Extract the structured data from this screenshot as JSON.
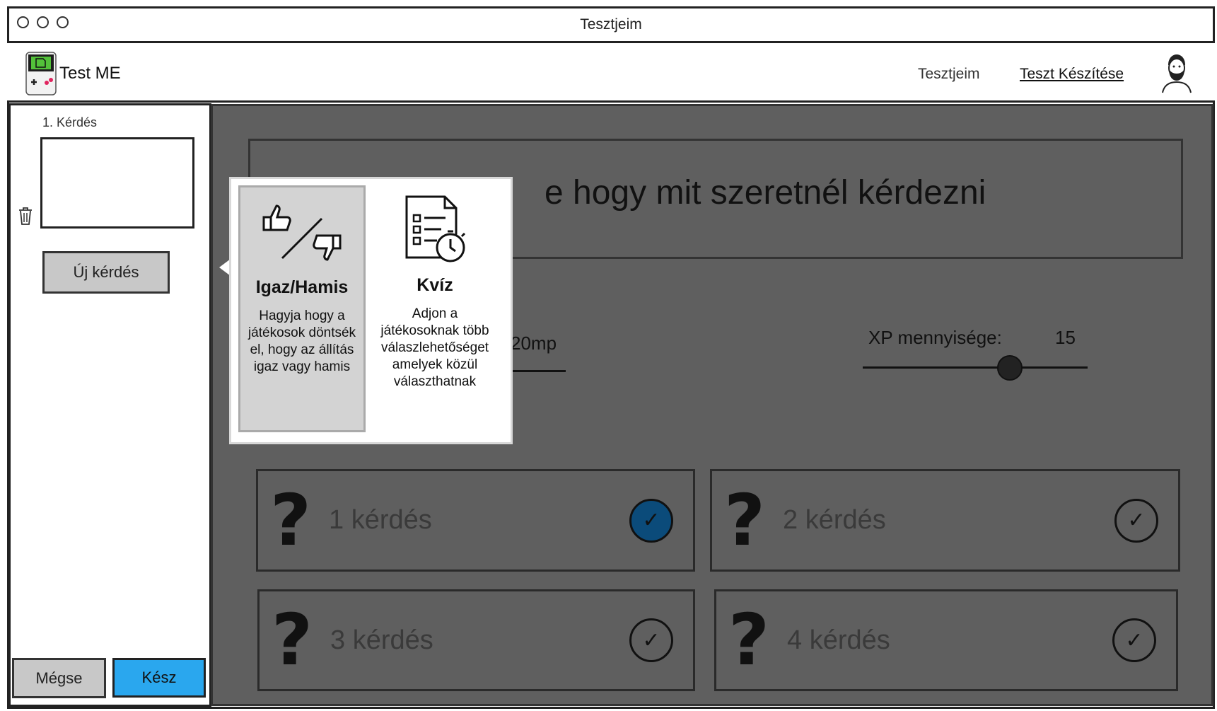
{
  "window": {
    "title": "Tesztjeim"
  },
  "header": {
    "logo_text": "Test ME",
    "nav": [
      {
        "label": "Tesztjeim"
      },
      {
        "label": "Teszt Készítése"
      }
    ]
  },
  "sidebar": {
    "question_label": "1. Kérdés",
    "new_question_label": "Új kérdés",
    "cancel_label": "Mégse",
    "done_label": "Kész"
  },
  "main": {
    "question_placeholder": "e hogy mit szeretnél kérdezni",
    "time_text": "20mp",
    "xp_label": "XP mennyisége:",
    "xp_value": "15",
    "xp_slider_fraction": 0.6,
    "questions": [
      {
        "label": "1 kérdés",
        "checked": true
      },
      {
        "label": "2 kérdés",
        "checked": false
      },
      {
        "label": "3 kérdés",
        "checked": false
      },
      {
        "label": "4 kérdés",
        "checked": false
      }
    ]
  },
  "popover": {
    "options": [
      {
        "title": "Igaz/Hamis",
        "description": "Hagyja hogy a játékosok döntsék el, hogy az állítás igaz vagy hamis",
        "icon": "thumbs-up-down-icon"
      },
      {
        "title": "Kvíz",
        "description": "Adjon a játékosoknak több válaszlehetőséget amelyek közül választhatnak",
        "icon": "quiz-timer-icon"
      }
    ]
  },
  "colors": {
    "done_button": "#2aa7ee",
    "overlay": "#5f5f5f",
    "active_check": "#0b4b7a"
  }
}
